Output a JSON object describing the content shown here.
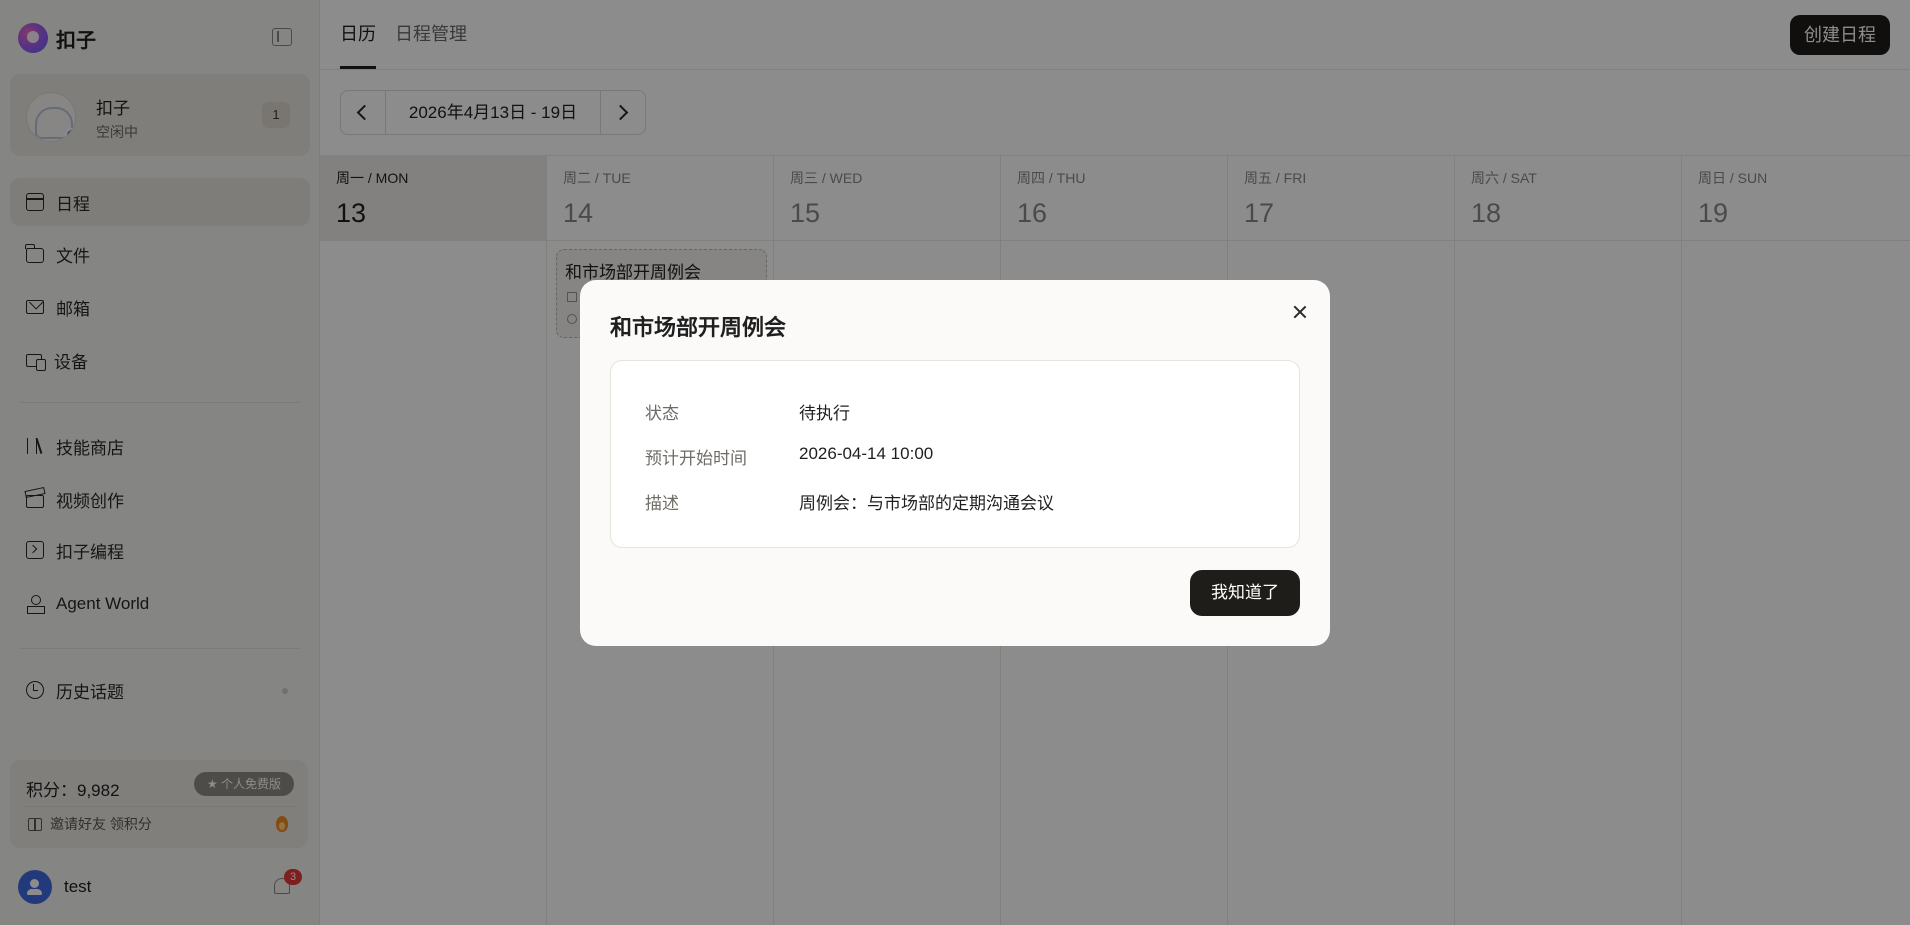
{
  "app": {
    "name": "扣子"
  },
  "agent": {
    "name": "扣子",
    "status": "空闲中",
    "count": "1"
  },
  "sidebar": {
    "items": [
      {
        "label": "日程"
      },
      {
        "label": "文件"
      },
      {
        "label": "邮箱"
      },
      {
        "label": "设备"
      },
      {
        "label": "技能商店"
      },
      {
        "label": "视频创作"
      },
      {
        "label": "扣子编程"
      },
      {
        "label": "Agent World"
      },
      {
        "label": "历史话题"
      }
    ]
  },
  "points": {
    "text": "积分：9,982",
    "plan": "★ 个人免费版",
    "invite": "邀请好友 领积分"
  },
  "user": {
    "name": "test",
    "notifications": "3"
  },
  "header": {
    "tabs": [
      {
        "label": "日历"
      },
      {
        "label": "日程管理"
      }
    ],
    "create_label": "创建日程"
  },
  "week": {
    "range": "2026年4月13日 - 19日"
  },
  "days": [
    {
      "label": "周一 / MON",
      "num": "13"
    },
    {
      "label": "周二 / TUE",
      "num": "14"
    },
    {
      "label": "周三 / WED",
      "num": "15"
    },
    {
      "label": "周四 / THU",
      "num": "16"
    },
    {
      "label": "周五 / FRI",
      "num": "17"
    },
    {
      "label": "周六 / SAT",
      "num": "18"
    },
    {
      "label": "周日 / SUN",
      "num": "19"
    }
  ],
  "event": {
    "title": "和市场部开周例会"
  },
  "modal": {
    "title": "和市场部开周例会",
    "rows": [
      {
        "key": "状态",
        "value": "待执行"
      },
      {
        "key": "预计开始时间",
        "value": "2026-04-14 10:00"
      },
      {
        "key": "描述",
        "value": "周例会：与市场部的定期沟通会议"
      }
    ],
    "confirm_label": "我知道了"
  }
}
